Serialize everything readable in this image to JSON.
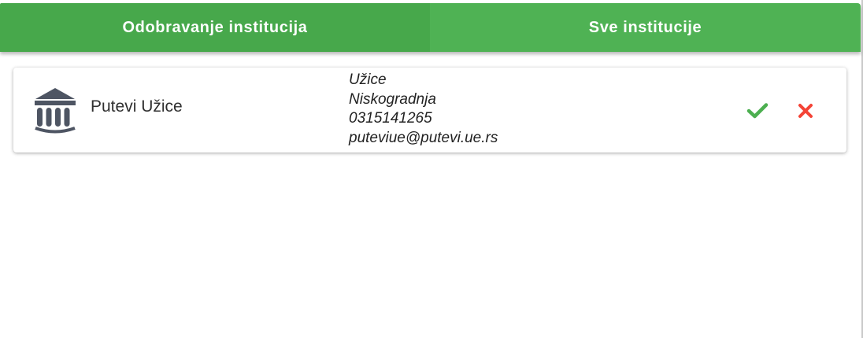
{
  "tabs": [
    {
      "label": "Odobravanje institucija",
      "active": true
    },
    {
      "label": "Sve institucije",
      "active": false
    }
  ],
  "colors": {
    "accent": "#4caf50",
    "approve": "#4caf50",
    "reject": "#f44336",
    "icon": "#4e5563"
  },
  "institution": {
    "icon": "institution-icon",
    "name": "Putevi Užice",
    "city": "Užice",
    "category": "Niskogradnja",
    "phone": "0315141265",
    "email": "puteviue@putevi.ue.rs"
  },
  "actions": {
    "approve_icon": "check-icon",
    "reject_icon": "close-icon"
  }
}
